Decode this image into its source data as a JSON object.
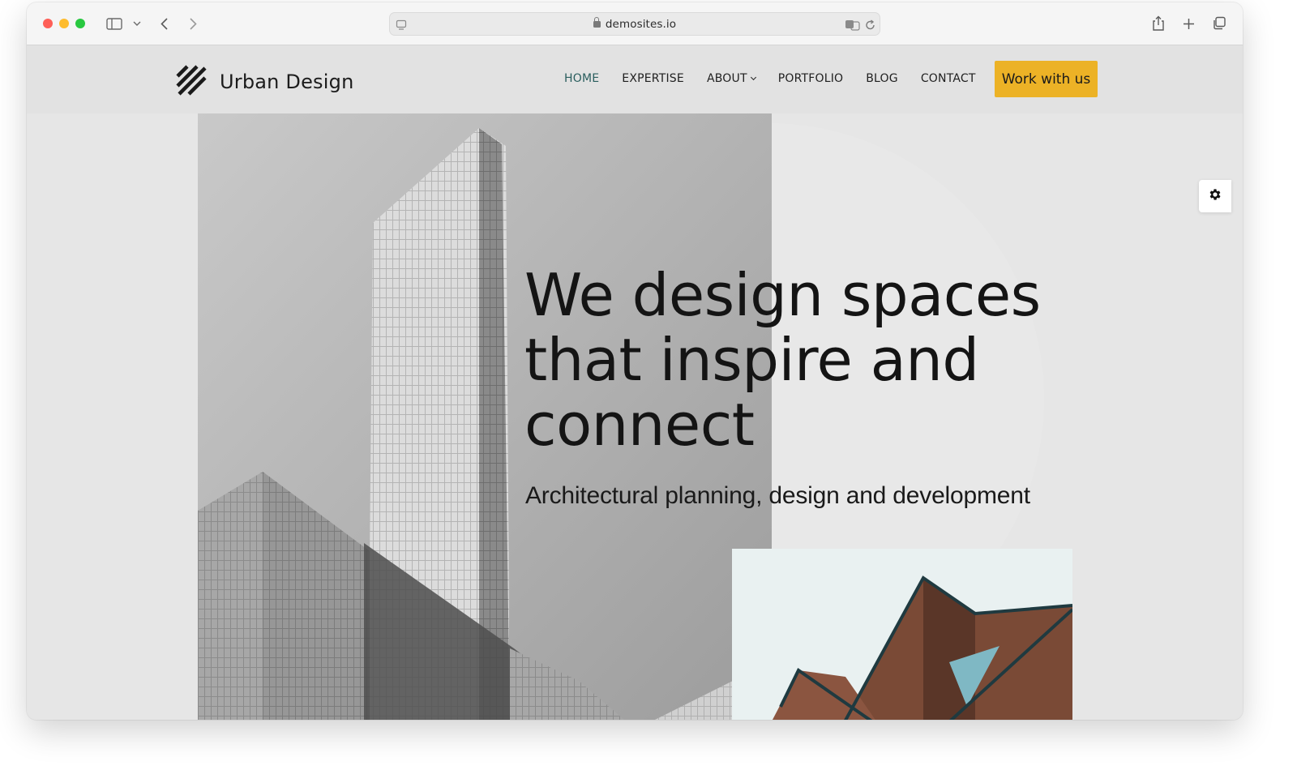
{
  "browser": {
    "url": "demosites.io"
  },
  "site": {
    "logo_text": "Urban Design",
    "nav": [
      {
        "label": "HOME",
        "active": true
      },
      {
        "label": "EXPERTISE"
      },
      {
        "label": "ABOUT",
        "has_dropdown": true
      },
      {
        "label": "PORTFOLIO"
      },
      {
        "label": "BLOG"
      },
      {
        "label": "CONTACT"
      }
    ],
    "cta_label": "Work with us"
  },
  "hero": {
    "headline_lines": [
      "We design spaces",
      "that inspire and",
      "connect"
    ],
    "subline": "Architectural planning, design and development"
  },
  "colors": {
    "accent": "#ecb226",
    "nav_active": "#2a5e5e",
    "page_bg": "#e6e6e6"
  },
  "icons": {
    "settings": "gear-icon"
  }
}
